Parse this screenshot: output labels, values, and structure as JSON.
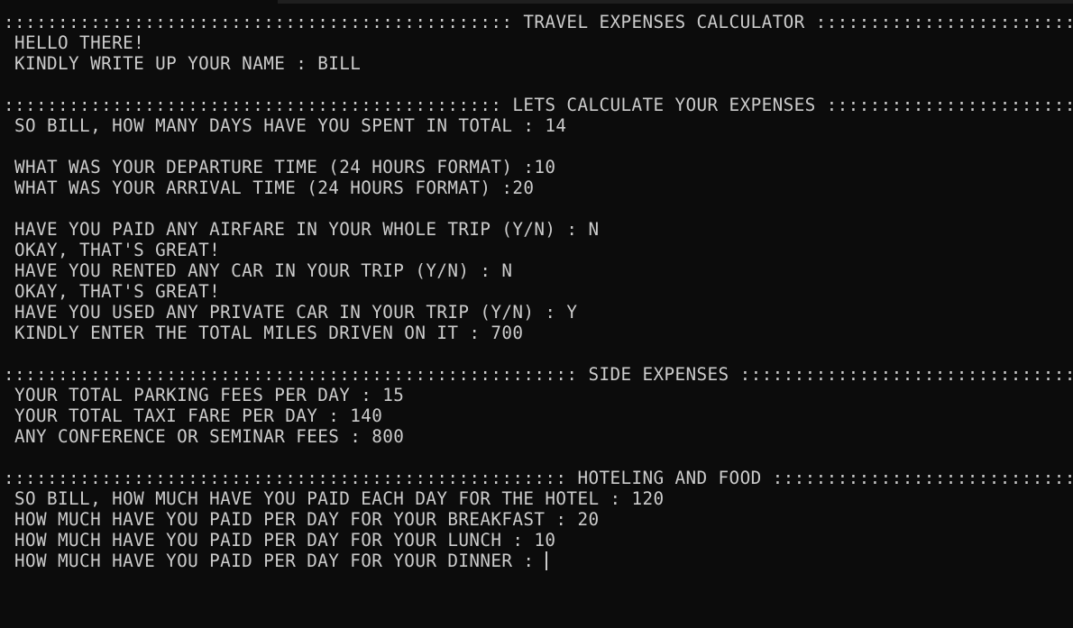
{
  "terminal": {
    "lines": [
      "::::::::::::::::::::::::::::::::::::::::::::::: TRAVEL EXPENSES CALCULATOR ::::::::::::::::::::::::::::::::::::::::::::::::",
      " HELLO THERE!",
      " KINDLY WRITE UP YOUR NAME : BILL",
      "",
      ":::::::::::::::::::::::::::::::::::::::::::::: LETS CALCULATE YOUR EXPENSES ::::::::::::::::::::::::::::::::::::::::::::::::",
      " SO BILL, HOW MANY DAYS HAVE YOU SPENT IN TOTAL : 14",
      "",
      " WHAT WAS YOUR DEPARTURE TIME (24 HOURS FORMAT) :10",
      " WHAT WAS YOUR ARRIVAL TIME (24 HOURS FORMAT) :20",
      "",
      " HAVE YOU PAID ANY AIRFARE IN YOUR WHOLE TRIP (Y/N) : N",
      " OKAY, THAT'S GREAT!",
      " HAVE YOU RENTED ANY CAR IN YOUR TRIP (Y/N) : N",
      " OKAY, THAT'S GREAT!",
      " HAVE YOU USED ANY PRIVATE CAR IN YOUR TRIP (Y/N) : Y",
      " KINDLY ENTER THE TOTAL MILES DRIVEN ON IT : 700",
      "",
      "::::::::::::::::::::::::::::::::::::::::::::::::::::: SIDE EXPENSES ::::::::::::::::::::::::::::::::::::::::::::::::::::::::",
      " YOUR TOTAL PARKING FEES PER DAY : 15",
      " YOUR TOTAL TAXI FARE PER DAY : 140",
      " ANY CONFERENCE OR SEMINAR FEES : 800",
      "",
      ":::::::::::::::::::::::::::::::::::::::::::::::::::: HOTELING AND FOOD :::::::::::::::::::::::::::::::::::::::::::::::::::::",
      " SO BILL, HOW MUCH HAVE YOU PAID EACH DAY FOR THE HOTEL : 120",
      " HOW MUCH HAVE YOU PAID PER DAY FOR YOUR BREAKFAST : 20",
      " HOW MUCH HAVE YOU PAID PER DAY FOR YOUR LUNCH : 10"
    ],
    "prompt_line": " HOW MUCH HAVE YOU PAID PER DAY FOR YOUR DINNER : ",
    "colors": {
      "background": "#0c0c0c",
      "text": "#cccccc"
    }
  }
}
